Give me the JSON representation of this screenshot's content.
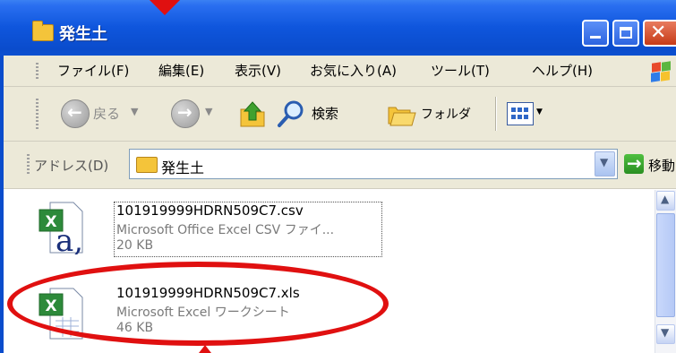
{
  "window": {
    "title": "発生土"
  },
  "menu": {
    "items": [
      "ファイル(F)",
      "編集(E)",
      "表示(V)",
      "お気に入り(A)",
      "ツール(T)",
      "ヘルプ(H)"
    ]
  },
  "toolbar": {
    "back_label": "戻る",
    "search_label": "検索",
    "folders_label": "フォルダ"
  },
  "address": {
    "label": "アドレス(D)",
    "value": "発生土",
    "go_label": "移動"
  },
  "files": [
    {
      "name": "101919999HDRN509C7.csv",
      "type": "Microsoft Office Excel CSV ファイ...",
      "size": "20 KB",
      "icon": "excel-csv-icon",
      "selected": true
    },
    {
      "name": "101919999HDRN509C7.xls",
      "type": "Microsoft Excel ワークシート",
      "size": "46 KB",
      "icon": "excel-xls-icon",
      "selected": false
    }
  ],
  "colors": {
    "titlebar": "#0a4ccc",
    "toolbar_bg": "#ece9d8",
    "annotation": "#e01010"
  }
}
